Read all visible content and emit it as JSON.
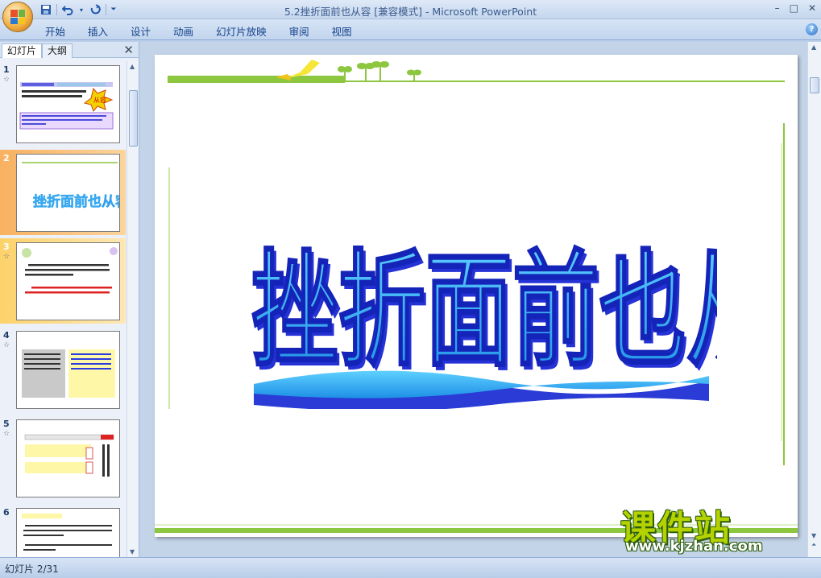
{
  "window": {
    "title": "5.2挫折面前也从容 [兼容模式] - Microsoft PowerPoint",
    "controls": [
      "–",
      "□",
      "✕"
    ]
  },
  "quick_access": {
    "save_icon": "save-icon",
    "undo_icon": "undo-icon",
    "redo_icon": "redo-icon",
    "customize_icon": "dropdown-icon"
  },
  "ribbon": {
    "tabs": [
      "开始",
      "插入",
      "设计",
      "动画",
      "幻灯片放映",
      "审阅",
      "视图"
    ],
    "help_label": "?"
  },
  "left_pane": {
    "tabs": [
      "幻灯片",
      "大纲"
    ],
    "close_label": "✕",
    "slides": [
      {
        "num": "1",
        "anim": "☆"
      },
      {
        "num": "2",
        "anim": ""
      },
      {
        "num": "3",
        "anim": "☆"
      },
      {
        "num": "4",
        "anim": "☆"
      },
      {
        "num": "5",
        "anim": "☆"
      },
      {
        "num": "6",
        "anim": "☆"
      }
    ],
    "thumb2_title": "挫折面前也从容",
    "thumb1_badge": "从容"
  },
  "slide": {
    "title": "挫折面前也从容"
  },
  "statusbar": {
    "slide_indicator": "幻灯片 2/31"
  },
  "watermark": {
    "main": "课件站",
    "url": "www.kjzhan.com"
  },
  "colors": {
    "accent_green": "#8dc63f",
    "title_blue": "#1e2fd8",
    "title_light": "#3aa9ef",
    "ribbon_text": "#15428b"
  }
}
